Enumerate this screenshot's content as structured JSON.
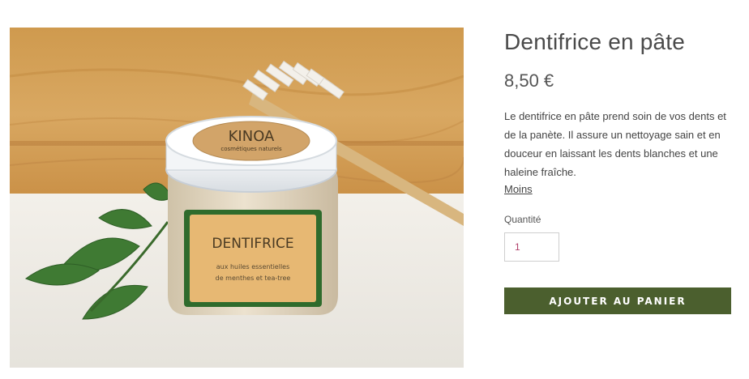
{
  "product": {
    "title": "Dentifrice en pâte",
    "price": "8,50 €",
    "description": "Le dentifrice en pâte prend soin de vos dents et de la panète. Il assure un nettoyage sain et en douceur en laissant les dents blanches et une haleine fraîche.",
    "less_link": "Moins",
    "quantity_label": "Quantité",
    "quantity_value": "1",
    "add_to_cart_label": "AJOUTER AU PANIER"
  },
  "image": {
    "lid_brand": "KINOA",
    "lid_subtitle": "cosmétiques naturels",
    "jar_label_title": "DENTIFRICE",
    "jar_label_line1": "aux huiles essentielles",
    "jar_label_line2": "de menthes et tea-tree"
  },
  "colors": {
    "accent": "#4b5f2e",
    "text": "#4a4a4a",
    "quantity_text": "#b1416b"
  }
}
